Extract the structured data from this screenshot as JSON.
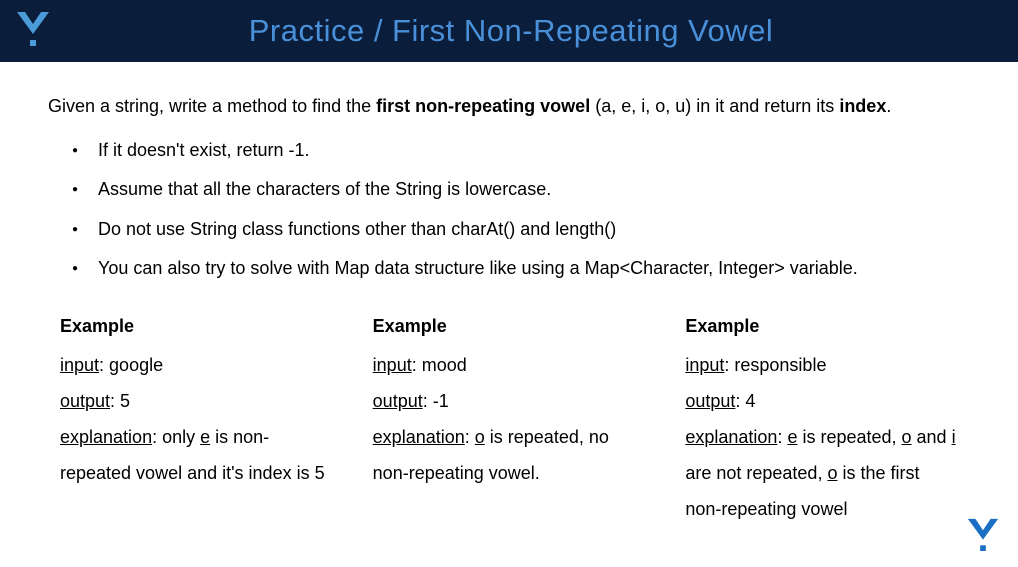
{
  "header": {
    "title": "Practice / First Non-Repeating Vowel"
  },
  "intro": {
    "prefix": "Given a string, write a method to find the ",
    "bold1": "first non-repeating vowel",
    "mid": " (a, e, i, o, u) in it and return its ",
    "bold2": "index",
    "suffix": "."
  },
  "bullets": [
    "If it doesn't exist, return -1.",
    "Assume that all the characters of the String is lowercase.",
    "Do not use String class functions other than charAt() and length()",
    "You can also try to solve with Map data structure like using a Map<Character, Integer> variable."
  ],
  "examples": [
    {
      "label": "Example",
      "input_label": "input",
      "input_value": ": google",
      "output_label": "output",
      "output_value": ": 5",
      "explanation_label": "explanation",
      "explanation_before": ": only ",
      "explanation_u1": "e",
      "explanation_after": " is non-repeated vowel and it's index is 5"
    },
    {
      "label": "Example",
      "input_label": "input",
      "input_value": ": mood",
      "output_label": "output",
      "output_value": ": -1",
      "explanation_label": "explanation",
      "explanation_before": ": ",
      "explanation_u1": "o",
      "explanation_after": " is repeated, no non-repeating vowel."
    },
    {
      "label": "Example",
      "input_label": "input",
      "input_value": ": responsible",
      "output_label": "output",
      "output_value": ": 4",
      "explanation_label": "explanation",
      "explanation_before": ": ",
      "explanation_u1": "e",
      "explanation_mid1": " is repeated, ",
      "explanation_u2": "o",
      "explanation_mid2": " and ",
      "explanation_u3": "i",
      "explanation_mid3": " are not repeated, ",
      "explanation_u4": "o",
      "explanation_after": " is the first non-repeating vowel"
    }
  ]
}
